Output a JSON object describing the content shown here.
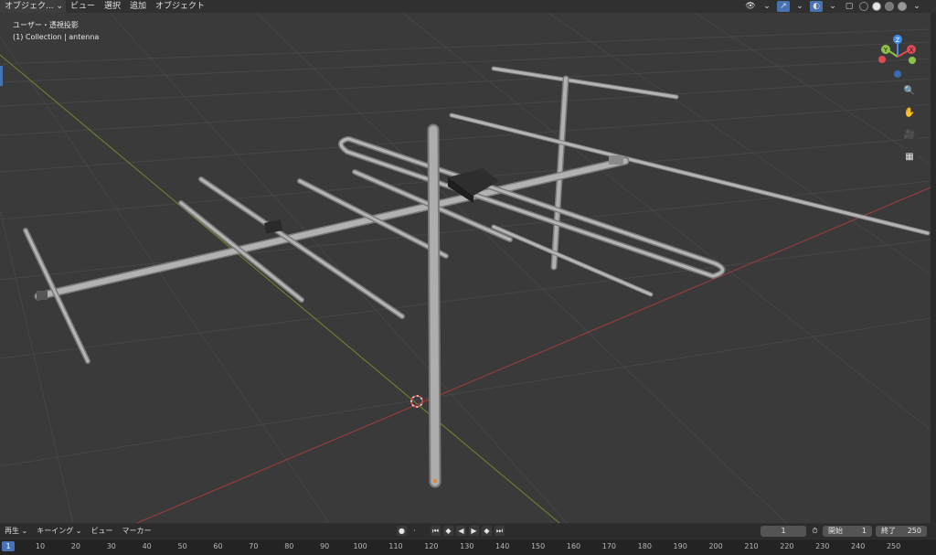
{
  "header": {
    "mode_label": "オブジェク...",
    "menu": [
      "ビュー",
      "選択",
      "追加",
      "オブジェクト"
    ]
  },
  "viewport": {
    "title": "ユーザー・透視投影",
    "subtitle": "(1) Collection | antenna"
  },
  "gizmo": {
    "axes": [
      "Z",
      "Y",
      "X"
    ],
    "colors": {
      "x": "#e04a55",
      "y": "#8bc34a",
      "z": "#3f8ff0"
    }
  },
  "nav_icons": [
    "zoom-icon",
    "pan-hand-icon",
    "camera-icon",
    "grid-icon"
  ],
  "timeline": {
    "menus": [
      "再生",
      "キーイング",
      "ビュー",
      "マーカー"
    ],
    "current_frame": "1",
    "start_label": "開始",
    "start_value": "1",
    "end_label": "終了",
    "end_value": "250",
    "ruler_current": "1",
    "ruler_ticks": [
      "10",
      "20",
      "30",
      "40",
      "50",
      "60",
      "70",
      "80",
      "90",
      "100",
      "110",
      "120",
      "130",
      "140",
      "150",
      "160",
      "170",
      "180",
      "190",
      "200",
      "210",
      "220",
      "230",
      "240",
      "250"
    ]
  },
  "colors": {
    "accent": "#4772b3",
    "x_axis": "#b84a4a",
    "y_axis": "#7a9a3a",
    "rod": "#a6a6a6"
  }
}
